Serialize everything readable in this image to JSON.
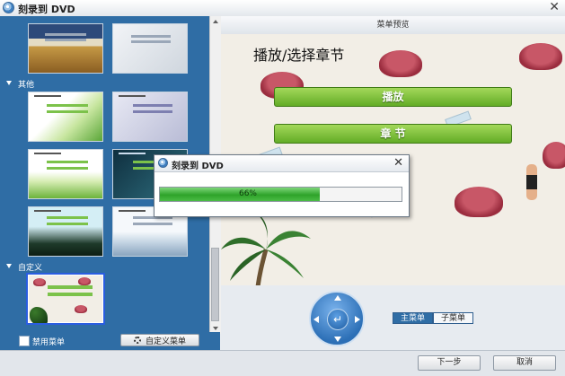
{
  "window": {
    "title": "刻录到 DVD",
    "close_glyph": "✕"
  },
  "left_panel": {
    "categories": [
      {
        "label": "其他"
      },
      {
        "label": "自定义"
      }
    ],
    "disable_menu_label": "禁用菜单",
    "custom_menu_button": "自定义菜单"
  },
  "preview": {
    "header": "菜单预览",
    "title": "播放/选择章节",
    "buttons": [
      "播放",
      "章 节"
    ]
  },
  "navigation": {
    "center_glyph": "↵",
    "tabs": [
      "主菜单",
      "子菜单"
    ],
    "active_tab": "主菜单"
  },
  "footer": {
    "next": "下一步",
    "cancel": "取消"
  },
  "dialog": {
    "title": "刻录到 DVD",
    "close_glyph": "✕",
    "progress": 0.66,
    "progress_text": "66%"
  },
  "colors": {
    "panel_blue": "#2f6da5",
    "button_green": "#63ac26",
    "progress_green": "#2ea32a"
  }
}
